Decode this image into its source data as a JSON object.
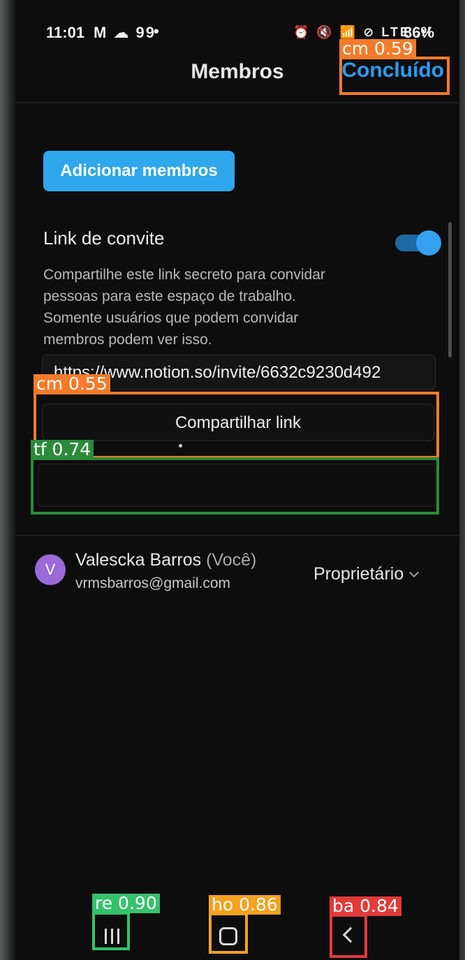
{
  "status_bar": {
    "time": "11:01",
    "left_icons": "M ☁ 99",
    "dot": "•",
    "right_icons": "⏰ 🔇 📶 ⊘ LTE .ıl",
    "battery": "86%"
  },
  "header": {
    "title": "Membros",
    "done_label": "Concluído"
  },
  "actions": {
    "add_members_label": "Adicionar membros"
  },
  "invite": {
    "label": "Link de convite",
    "toggle_on": true,
    "description": "Compartilhe este link secreto para convidar pessoas para este espaço de trabalho. Somente usuários que podem convidar membros podem ver isso.",
    "link": "https://www.notion.so/invite/6632c9230d492",
    "share_label": "Compartilhar link"
  },
  "members": [
    {
      "avatar_letter": "V",
      "name": "Valescka Barros",
      "you_tag": "(Você)",
      "email": "vrmsbarros@gmail.com",
      "role": "Proprietário"
    }
  ],
  "detections": {
    "done": "cm 0.59",
    "share": "cm 0.55",
    "field": "tf 0.74",
    "recents": "re 0.90",
    "home": "ho 0.86",
    "back": "ba 0.84"
  },
  "colors": {
    "accent": "#2ea7ec",
    "done_text": "#2a9df4",
    "background": "#0d0d0e",
    "avatar": "#9b6ad9"
  },
  "icons": {
    "recents": "recents-icon",
    "home": "home-icon",
    "back": "back-icon",
    "dropdown": "chevron-down-icon"
  }
}
